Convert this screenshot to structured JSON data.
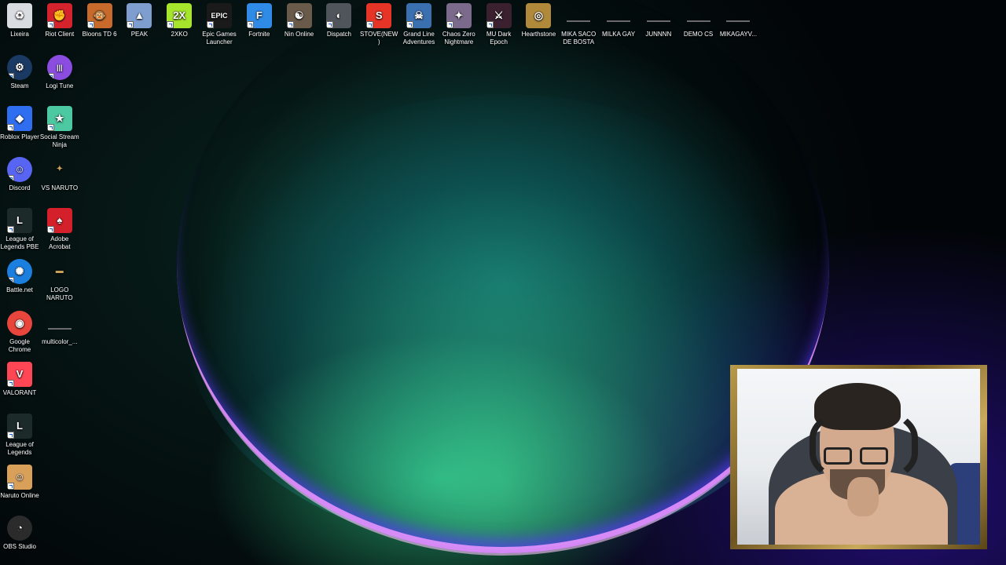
{
  "desktop": {
    "top_row": [
      {
        "label": "Lixeira",
        "icon": "recycle-bin-icon",
        "color": "#d9dde2",
        "glyph": "♻",
        "name": "desktop-icon-lixeira",
        "shortcut": false
      },
      {
        "label": "Riot Client",
        "icon": "riot-client-icon",
        "color": "#d5232d",
        "glyph": "✊",
        "name": "desktop-icon-riot-client",
        "shortcut": true
      },
      {
        "label": "Bloons TD 6",
        "icon": "bloons-monkey-icon",
        "color": "#c86a2b",
        "glyph": "🐵",
        "name": "desktop-icon-bloons-td-6",
        "shortcut": true
      },
      {
        "label": "PEAK",
        "icon": "mountain-icon",
        "color": "#7f9ed0",
        "glyph": "▲",
        "name": "desktop-icon-peak",
        "shortcut": true
      },
      {
        "label": "2XKO",
        "icon": "2xko-logo-icon",
        "color": "#a6e52b",
        "glyph": "2X",
        "name": "desktop-icon-2xko",
        "shortcut": true
      },
      {
        "label": "Epic Games Launcher",
        "icon": "epic-games-icon",
        "color": "#1a1a1a",
        "glyph": "EPIC",
        "name": "desktop-icon-epic-games",
        "shortcut": true
      },
      {
        "label": "Fortnite",
        "icon": "fortnite-icon",
        "color": "#2f8be6",
        "glyph": "F",
        "name": "desktop-icon-fortnite",
        "shortcut": true
      },
      {
        "label": "Nin Online",
        "icon": "ninja-icon",
        "color": "#6a5a4a",
        "glyph": "☯",
        "name": "desktop-icon-nin-online",
        "shortcut": true
      },
      {
        "label": "Dispatch",
        "icon": "dispatch-icon",
        "color": "#50555c",
        "glyph": "◐",
        "name": "desktop-icon-dispatch",
        "shortcut": true
      },
      {
        "label": "STOVE(NEW)",
        "icon": "stove-icon",
        "color": "#e63426",
        "glyph": "S",
        "name": "desktop-icon-stove",
        "shortcut": true
      },
      {
        "label": "Grand Line Adventures",
        "icon": "one-piece-icon",
        "color": "#3a6fb0",
        "glyph": "☠",
        "name": "desktop-icon-grand-line",
        "shortcut": true
      },
      {
        "label": "Chaos Zero Nightmare",
        "icon": "chaos-zero-icon",
        "color": "#7b6a8c",
        "glyph": "✦",
        "name": "desktop-icon-chaos-zero",
        "shortcut": true
      },
      {
        "label": "MU Dark Epoch",
        "icon": "mu-dark-epoch-icon",
        "color": "#3b2030",
        "glyph": "⚔",
        "name": "desktop-icon-mu-dark-epoch",
        "shortcut": true
      },
      {
        "label": "Hearthstone",
        "icon": "hearthstone-icon",
        "color": "#b08a3a",
        "glyph": "◎",
        "name": "desktop-icon-hearthstone",
        "shortcut": false
      },
      {
        "label": "MIKA SACO DE BOSTA",
        "icon": "thin-image-icon",
        "color": "",
        "glyph": "",
        "name": "desktop-icon-mika-saco",
        "shortcut": false,
        "thin": true
      },
      {
        "label": "MILKA GAY",
        "icon": "thin-image-icon",
        "color": "",
        "glyph": "",
        "name": "desktop-icon-milka-gay",
        "shortcut": false,
        "thin": true
      },
      {
        "label": "JUNNNN",
        "icon": "thin-image-icon",
        "color": "",
        "glyph": "",
        "name": "desktop-icon-junnnn",
        "shortcut": false,
        "thin": true
      },
      {
        "label": "DEMO CS",
        "icon": "thin-image-icon",
        "color": "",
        "glyph": "",
        "name": "desktop-icon-demo-cs",
        "shortcut": false,
        "thin": true
      },
      {
        "label": "MIKAGAYV...",
        "icon": "thin-image-icon",
        "color": "",
        "glyph": "",
        "name": "desktop-icon-mikagayv",
        "shortcut": false,
        "thin": true
      }
    ],
    "col1": [
      {
        "label": "Steam",
        "icon": "steam-icon",
        "color": "#1b3a63",
        "glyph": "⚙",
        "name": "desktop-icon-steam",
        "shortcut": true,
        "round": true
      },
      {
        "label": "Roblox Player",
        "icon": "roblox-icon",
        "color": "#2f6ef0",
        "glyph": "◆",
        "name": "desktop-icon-roblox",
        "shortcut": true
      },
      {
        "label": "Discord",
        "icon": "discord-icon",
        "color": "#5865f2",
        "glyph": "☺",
        "name": "desktop-icon-discord",
        "shortcut": true,
        "round": true
      },
      {
        "label": "League of Legends PBE",
        "icon": "league-pbe-icon",
        "color": "#1d2a2a",
        "glyph": "L",
        "name": "desktop-icon-league-pbe",
        "shortcut": true
      },
      {
        "label": "Battle.net",
        "icon": "battlenet-icon",
        "color": "#1b7fe0",
        "glyph": "✺",
        "name": "desktop-icon-battlenet",
        "shortcut": true,
        "round": true
      },
      {
        "label": "Google Chrome",
        "icon": "chrome-icon",
        "color": "#e8453c",
        "glyph": "◉",
        "name": "desktop-icon-chrome",
        "shortcut": false,
        "round": true
      },
      {
        "label": "VALORANT",
        "icon": "valorant-icon",
        "color": "#ff4655",
        "glyph": "V",
        "name": "desktop-icon-valorant",
        "shortcut": true
      },
      {
        "label": "League of Legends",
        "icon": "league-icon",
        "color": "#1d2a2a",
        "glyph": "L",
        "name": "desktop-icon-league",
        "shortcut": true
      },
      {
        "label": "Naruto Online",
        "icon": "naruto-icon",
        "color": "#d9a05a",
        "glyph": "☺",
        "name": "desktop-icon-naruto-online",
        "shortcut": true
      },
      {
        "label": "OBS Studio",
        "icon": "obs-icon",
        "color": "#2b2b2b",
        "glyph": "◔",
        "name": "desktop-icon-obs",
        "shortcut": false,
        "round": true
      }
    ],
    "col2": [
      {
        "label": "Logi Tune",
        "icon": "logi-tune-icon",
        "color": "#8a4de0",
        "glyph": "|||",
        "name": "desktop-icon-logi-tune",
        "shortcut": true,
        "round": true
      },
      {
        "label": "Social Stream Ninja",
        "icon": "social-stream-icon",
        "color": "#4cc9a0",
        "glyph": "★",
        "name": "desktop-icon-social-stream",
        "shortcut": true
      },
      {
        "label": "VS NARUTO",
        "icon": "vs-naruto-icon",
        "color": "",
        "glyph": "✦",
        "name": "desktop-icon-vs-naruto",
        "shortcut": false,
        "small": true
      },
      {
        "label": "Adobe Acrobat",
        "icon": "acrobat-icon",
        "color": "#d4202a",
        "glyph": "♠",
        "name": "desktop-icon-acrobat",
        "shortcut": true
      },
      {
        "label": "LOGO NARUTO",
        "icon": "logo-naruto-icon",
        "color": "",
        "glyph": "▬",
        "name": "desktop-icon-logo-naruto",
        "shortcut": false,
        "small": true
      },
      {
        "label": "multicolor_...",
        "icon": "thin-image-icon",
        "color": "",
        "glyph": "",
        "name": "desktop-icon-multicolor",
        "shortcut": false,
        "thin": true
      }
    ]
  }
}
